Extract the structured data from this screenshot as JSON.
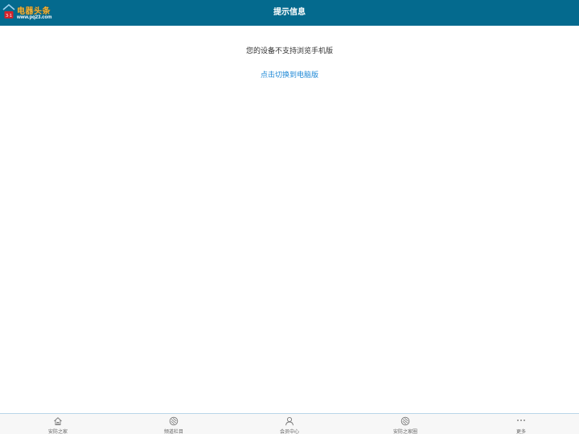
{
  "header": {
    "logo_title": "电器头条",
    "logo_url": "www.pq23.com",
    "title": "提示信息"
  },
  "main": {
    "message": "您的设备不支持浏览手机版",
    "switch_link": "点击切换到电脑版"
  },
  "bottom_nav": {
    "items": [
      {
        "label": "安防之家",
        "icon": "home-icon"
      },
      {
        "label": "频道栏目",
        "icon": "compass-icon"
      },
      {
        "label": "会员中心",
        "icon": "user-icon"
      },
      {
        "label": "安防之家圈",
        "icon": "compass-icon"
      },
      {
        "label": "更多",
        "icon": "more-icon"
      }
    ]
  },
  "colors": {
    "header_bg": "#046a8e",
    "link": "#1e88d6",
    "logo_gold": "#f2b33a",
    "logo_red": "#d4232b"
  }
}
